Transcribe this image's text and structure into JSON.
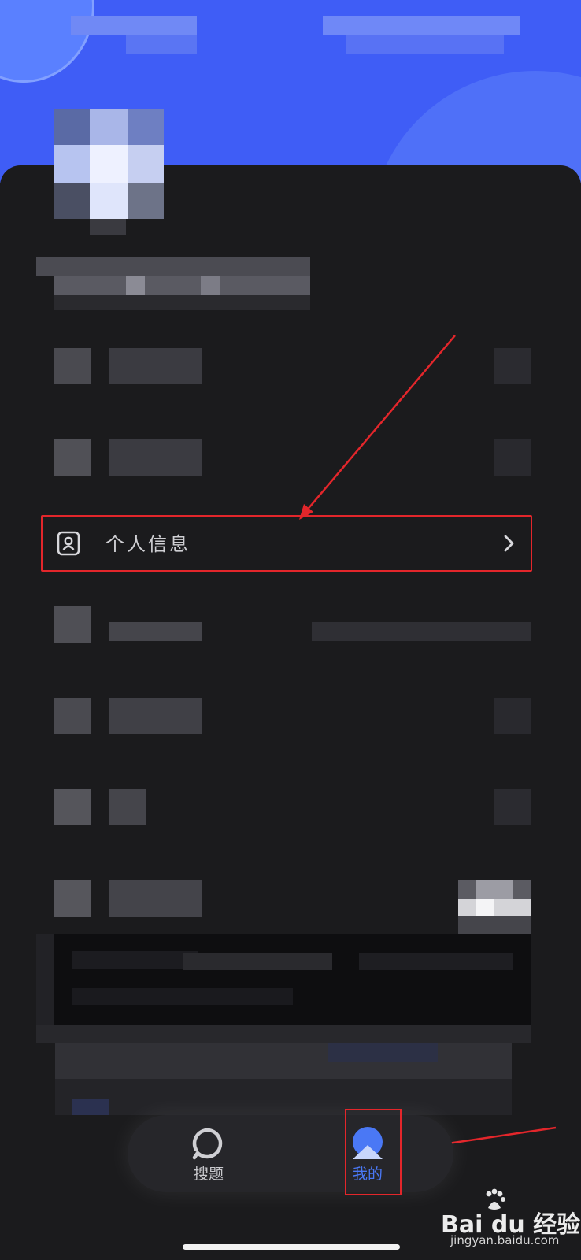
{
  "menu": {
    "personal_info": {
      "label": "个人信息",
      "icon": "person-card-icon",
      "chevron": "chevron-right-icon"
    }
  },
  "tabbar": {
    "tabs": [
      {
        "label": "搜题",
        "icon": "search-icon",
        "active": false
      },
      {
        "label": "我的",
        "icon": "profile-icon",
        "active": true
      }
    ]
  },
  "watermark": {
    "brand": "Bai du 经验",
    "url": "jingyan.baidu.com"
  },
  "colors": {
    "header_blue": "#3f5df6",
    "background": "#1b1b1d",
    "accent": "#4a78f5",
    "annotation_red": "#e3262b",
    "tab_inactive": "#c8c8cc"
  }
}
